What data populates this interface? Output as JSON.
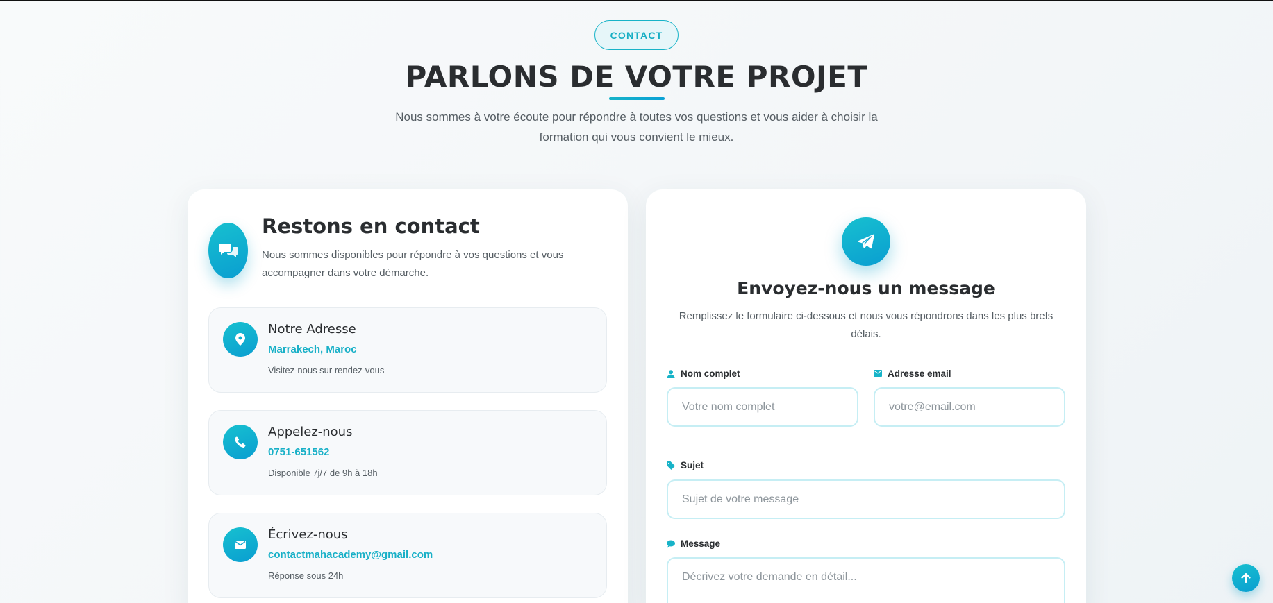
{
  "header": {
    "badge": "CONTACT",
    "title": "PARLONS DE VOTRE PROJET",
    "lead": "Nous sommes à votre écoute pour répondre à toutes vos questions et vous aider à choisir la formation qui vous convient le mieux."
  },
  "contact_card": {
    "title": "Restons en contact",
    "description": "Nous sommes disponibles pour répondre à vos questions et vous accompagner dans votre démarche.",
    "items": [
      {
        "icon": "map-pin-icon",
        "title": "Notre Adresse",
        "value": "Marrakech, Maroc",
        "note": "Visitez-nous sur rendez-vous"
      },
      {
        "icon": "phone-icon",
        "title": "Appelez-nous",
        "value": "0751-651562",
        "note": "Disponible 7j/7 de 9h à 18h"
      },
      {
        "icon": "envelope-icon",
        "title": "Écrivez-nous",
        "value": "contactmahacademy@gmail.com",
        "note": "Réponse sous 24h"
      }
    ]
  },
  "form_card": {
    "title": "Envoyez-nous un message",
    "description": "Remplissez le formulaire ci-dessous et nous vous répondrons dans les plus brefs délais.",
    "fields": {
      "name": {
        "label": "Nom complet",
        "placeholder": "Votre nom complet",
        "value": ""
      },
      "email": {
        "label": "Adresse email",
        "placeholder": "votre@email.com",
        "value": ""
      },
      "subject": {
        "label": "Sujet",
        "placeholder": "Sujet de votre message",
        "value": ""
      },
      "message": {
        "label": "Message",
        "placeholder": "Décrivez votre demande en détail...",
        "value": ""
      }
    }
  },
  "colors": {
    "accent": "#17b3c8",
    "accent_dark": "#0a9ed1",
    "text": "#2a2d30",
    "muted": "#555d63"
  }
}
